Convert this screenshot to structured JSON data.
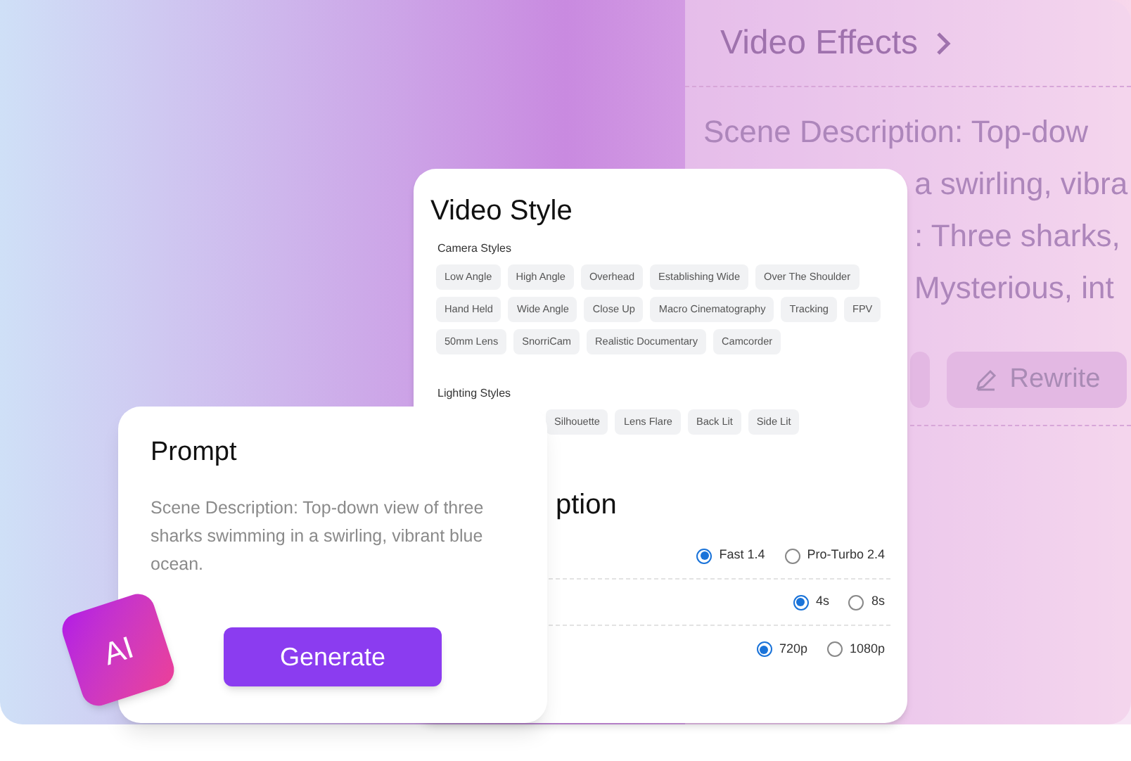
{
  "effects_panel": {
    "title": "Video Effects",
    "lines": [
      {
        "text": "Scene Description: Top-dow"
      },
      {
        "text": "a swirling, vibra"
      },
      {
        "text": ": Three sharks,"
      },
      {
        "text": "Mysterious, int"
      }
    ],
    "buttons": [
      {
        "kind": "plain"
      },
      {
        "label": "Rewrite",
        "kind": "rewrite"
      }
    ]
  },
  "video_style": {
    "title": "Video Style",
    "sections": [
      {
        "title": "Camera Styles",
        "rows": [
          [
            "Low Angle",
            "High Angle",
            "Overhead",
            "Establishing Wide",
            "Over The Shoulder"
          ],
          [
            "Hand Held",
            "Wide Angle",
            "Close Up",
            "Macro Cinematography",
            "Tracking",
            "FPV"
          ],
          [
            "50mm Lens",
            "SnorriCam",
            "Realistic Documentary",
            "Camcorder"
          ]
        ]
      },
      {
        "title": "Lighting Styles",
        "rows": [
          [
            "Silhouette",
            "Lens Flare",
            "Back Lit",
            "Side Lit"
          ]
        ]
      }
    ]
  },
  "video_option": {
    "title": "ption",
    "rows": [
      {
        "choices": [
          {
            "label": "Fast 1.4",
            "selected": true
          },
          {
            "label": "Pro-Turbo 2.4",
            "selected": false
          }
        ]
      },
      {
        "choices": [
          {
            "label": "4s",
            "selected": true
          },
          {
            "label": "8s",
            "selected": false
          }
        ]
      },
      {
        "choices": [
          {
            "label": "720p",
            "selected": true
          },
          {
            "label": "1080p",
            "selected": false
          }
        ]
      }
    ]
  },
  "prompt": {
    "title": "Prompt",
    "text": "Scene Description: Top-down view of three sharks swimming in a swirling, vibrant blue ocean.",
    "button": "Generate"
  },
  "badge": {
    "label": "AI"
  }
}
